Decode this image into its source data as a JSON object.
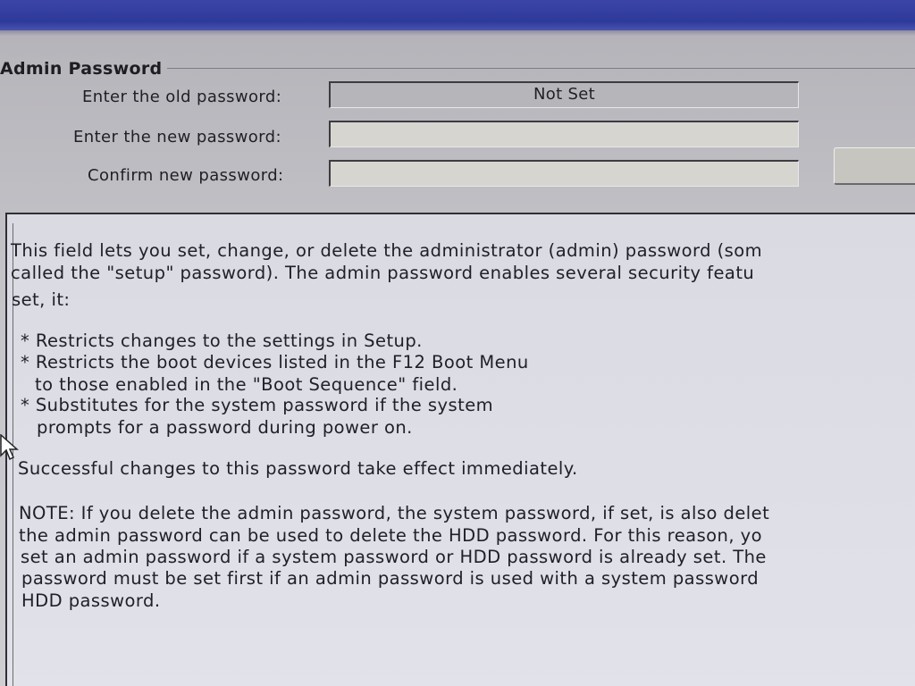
{
  "group": {
    "title": "Admin Password"
  },
  "fields": [
    {
      "label": "Enter the old password:",
      "value": "Not Set"
    },
    {
      "label": "Enter the new password:",
      "value": ""
    },
    {
      "label": "Confirm new password:",
      "value": ""
    }
  ],
  "help": {
    "intro_line1": "This field lets you set, change, or delete the administrator (admin) password (som",
    "intro_line2": "called the \"setup\" password).  The admin password enables several security featu",
    "intro_line3": "set, it:",
    "bullet1": "* Restricts changes to the settings in Setup.",
    "bullet2_line1": "* Restricts the boot devices listed in the F12 Boot Menu",
    "bullet2_line2": "to those enabled in the \"Boot Sequence\" field.",
    "bullet3_line1": "* Substitutes for the system password if the system",
    "bullet3_line2": "prompts for a password during power on.",
    "success": "Successful changes to this password take effect immediately.",
    "note_line1": "NOTE: If you delete the admin password, the system password, if set, is also delet",
    "note_line2": "the admin password can be used to delete the HDD password.  For this reason, yo",
    "note_line3": "set an admin password if a system password or HDD password is already set. The",
    "note_line4": "password must be set first if an admin password is used with a system password",
    "note_line5": "HDD password."
  },
  "icons": {
    "cursor": "mouse-pointer-icon"
  }
}
